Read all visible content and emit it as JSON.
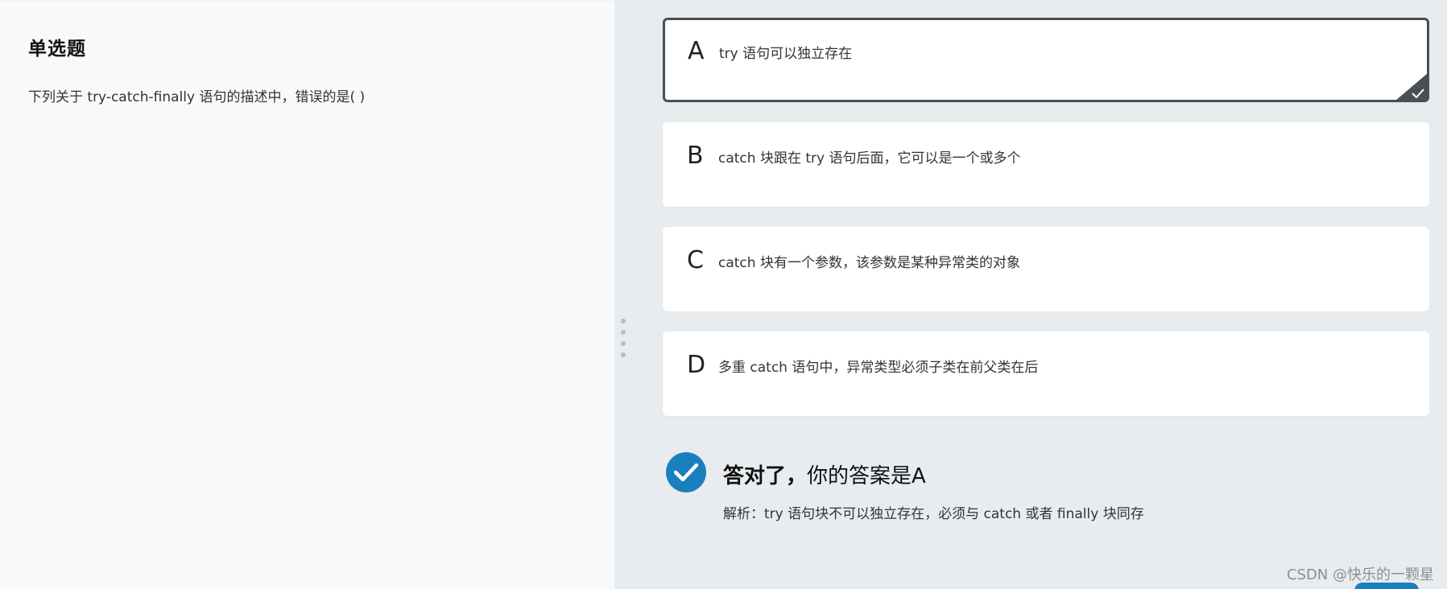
{
  "question": {
    "type_label": "单选题",
    "text": "下列关于 try-catch-finally 语句的描述中，错误的是( )"
  },
  "options": [
    {
      "letter": "A",
      "text": "try 语句可以独立存在",
      "selected": true
    },
    {
      "letter": "B",
      "text": "catch 块跟在 try 语句后面，它可以是一个或多个",
      "selected": false
    },
    {
      "letter": "C",
      "text": "catch 块有一个参数，该参数是某种异常类的对象",
      "selected": false
    },
    {
      "letter": "D",
      "text": "多重 catch 语句中，异常类型必须子类在前父类在后",
      "selected": false
    }
  ],
  "result": {
    "title_strong": "答对了，",
    "title_rest": "你的答案是A",
    "analysis": "解析：try 语句块不可以独立存在，必须与 catch 或者 finally 块同存"
  },
  "watermark": "CSDN @快乐的一颗星",
  "colors": {
    "accent": "#1a80bd",
    "selected_border": "#474f57",
    "left_bg": "#f8f9fb",
    "right_bg": "#e8ecef"
  },
  "icons": {
    "selected_corner": "checkmark-icon",
    "result": "check-circle-icon",
    "handle": "drag-handle-icon"
  }
}
